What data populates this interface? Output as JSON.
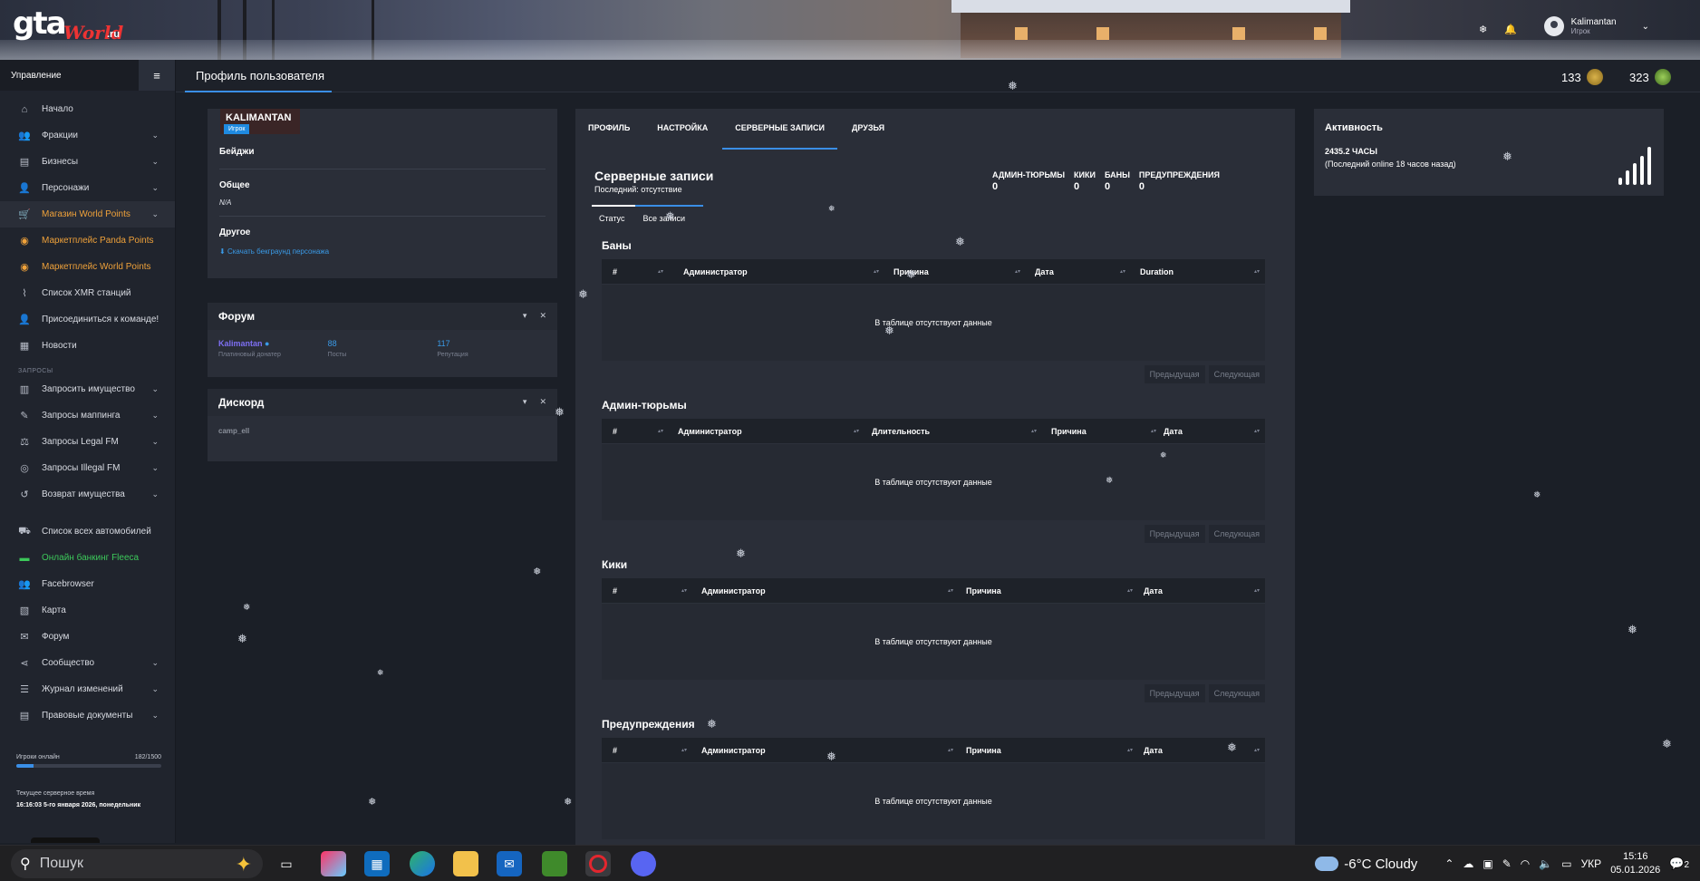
{
  "banner": {
    "logo_main": "gta",
    "logo_world": "World",
    "logo_ru": ".ru",
    "user_name": "Kalimantan",
    "user_role": "Игрок",
    "icons": [
      "snowflake-icon",
      "bell-icon",
      "chevron-down-icon"
    ]
  },
  "sidebar": {
    "title": "Управление",
    "items_main": [
      {
        "label": "Начало",
        "icon": "home-icon",
        "chev": false,
        "style": "normal"
      },
      {
        "label": "Фракции",
        "icon": "users-icon",
        "chev": true,
        "style": "normal"
      },
      {
        "label": "Бизнесы",
        "icon": "briefcase-icon",
        "chev": true,
        "style": "normal"
      },
      {
        "label": "Персонажи",
        "icon": "user-icon",
        "chev": true,
        "style": "normal"
      },
      {
        "label": "Магазин World Points",
        "icon": "cart-icon",
        "chev": true,
        "style": "orange-active"
      },
      {
        "label": "Маркетплейс Panda Points",
        "icon": "coins-icon",
        "chev": false,
        "style": "orange"
      },
      {
        "label": "Маркетплейс World Points",
        "icon": "coins-icon",
        "chev": false,
        "style": "orange"
      },
      {
        "label": "Список XMR станций",
        "icon": "antenna-icon",
        "chev": false,
        "style": "normal"
      },
      {
        "label": "Присоединиться к команде!",
        "icon": "user-plus-icon",
        "chev": false,
        "style": "normal"
      },
      {
        "label": "Новости",
        "icon": "newspaper-icon",
        "chev": false,
        "style": "normal"
      }
    ],
    "section_requests": "ЗАПРОСЫ",
    "items_requests": [
      {
        "label": "Запросить имущество",
        "icon": "building-icon",
        "chev": true,
        "style": "normal"
      },
      {
        "label": "Запросы маппинга",
        "icon": "brush-icon",
        "chev": true,
        "style": "normal"
      },
      {
        "label": "Запросы Legal FM",
        "icon": "scale-icon",
        "chev": true,
        "style": "normal"
      },
      {
        "label": "Запросы Illegal FM",
        "icon": "mask-icon",
        "chev": true,
        "style": "normal"
      },
      {
        "label": "Возврат имущества",
        "icon": "undo-icon",
        "chev": true,
        "style": "normal"
      }
    ],
    "items_other": [
      {
        "label": "Список всех автомобилей",
        "icon": "car-icon",
        "chev": false,
        "style": "normal"
      },
      {
        "label": "Онлайн банкинг Fleeca",
        "icon": "bank-card-icon",
        "chev": false,
        "style": "green"
      },
      {
        "label": "Facebrowser",
        "icon": "people-icon",
        "chev": false,
        "style": "normal"
      },
      {
        "label": "Карта",
        "icon": "map-icon",
        "chev": false,
        "style": "normal"
      },
      {
        "label": "Форум",
        "icon": "chat-icon",
        "chev": false,
        "style": "normal"
      },
      {
        "label": "Сообщество",
        "icon": "share-icon",
        "chev": true,
        "style": "normal"
      },
      {
        "label": "Журнал изменений",
        "icon": "list-icon",
        "chev": true,
        "style": "normal"
      },
      {
        "label": "Правовые документы",
        "icon": "document-icon",
        "chev": true,
        "style": "normal"
      }
    ],
    "online_label": "Игроки онлайн",
    "online_value": "182/1500",
    "online_fraction": 0.1213,
    "server_time_label": "Текущее серверное время",
    "server_time_value": "16:16:03 5-го января 2026, понедельник"
  },
  "topbar": {
    "title": "Профиль пользователя",
    "stat1": "133",
    "stat2": "323"
  },
  "profile": {
    "name": "KALIMANTAN",
    "role": "Игрок",
    "badges_label": "Бейджи",
    "general_label": "Общее",
    "general_value": "N/A",
    "other_label": "Другое",
    "download_link": "Скачать бекграунд персонажа"
  },
  "forum": {
    "title": "Форум",
    "user": "Kalimantan",
    "user_sub": "Платиновый донатер",
    "posts": "88",
    "posts_label": "Посты",
    "reputation": "117",
    "reputation_label": "Репутация"
  },
  "discord": {
    "title": "Дискорд",
    "value": "camp_ell"
  },
  "records": {
    "tabs": [
      "ПРОФИЛЬ",
      "НАСТРОЙКА",
      "СЕРВЕРНЫЕ ЗАПИСИ",
      "ДРУЗЬЯ"
    ],
    "title": "Серверные записи",
    "subtitle": "Последний: отсутствие",
    "counters": [
      {
        "k": "АДМИН-ТЮРЬМЫ",
        "v": "0"
      },
      {
        "k": "КИКИ",
        "v": "0"
      },
      {
        "k": "БАНЫ",
        "v": "0"
      },
      {
        "k": "ПРЕДУПРЕЖДЕНИЯ",
        "v": "0"
      }
    ],
    "subtabs": [
      "Статус",
      "Все записи"
    ],
    "empty_text": "В таблице отсутствуют данные",
    "prev": "Предыдущая",
    "next": "Следующая",
    "bans": {
      "title": "Баны",
      "cols": [
        "#",
        "Администратор",
        "Причина",
        "Дата",
        "Duration"
      ]
    },
    "jails": {
      "title": "Админ-тюрьмы",
      "cols": [
        "#",
        "Администратор",
        "Длительность",
        "Причина",
        "Дата"
      ]
    },
    "kicks": {
      "title": "Кики",
      "cols": [
        "#",
        "Администратор",
        "Причина",
        "Дата"
      ]
    },
    "warns": {
      "title": "Предупреждения",
      "cols": [
        "#",
        "Администратор",
        "Причина",
        "Дата"
      ]
    }
  },
  "activity": {
    "title": "Активность",
    "hours": "2435.2 ЧАСЫ",
    "last": "(Последний online 18 часов назад)"
  },
  "taskbar": {
    "search": "Пошук",
    "weather": "-6°C  Cloudy",
    "lang": "УКР",
    "time": "15:16",
    "date": "05.01.2026",
    "notif": "2"
  }
}
